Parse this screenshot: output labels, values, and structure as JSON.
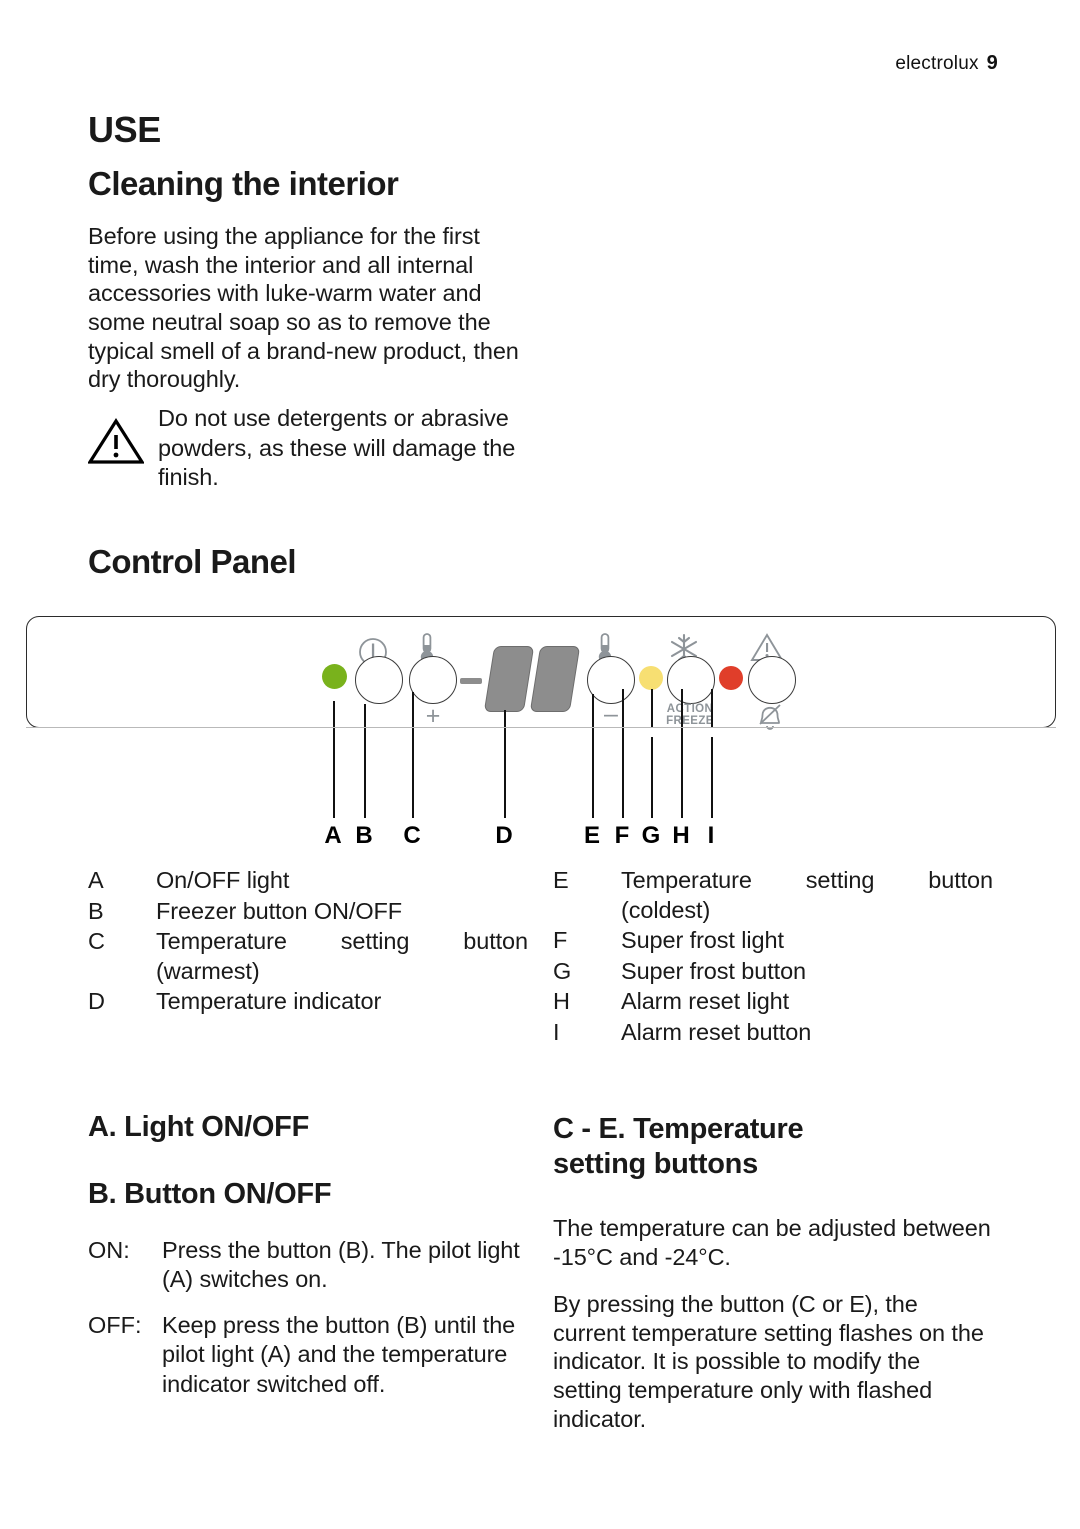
{
  "header": {
    "brand": "electrolux",
    "page_number": "9"
  },
  "sections": {
    "use_title": "USE",
    "cleaning_title": "Cleaning the interior",
    "cleaning_body": "Before using the appliance for the first time, wash the interior and all internal accessories with luke-warm water and some neutral soap so as to remove the typical smell of a brand-new product, then dry thoroughly.",
    "warning_text": "Do not use detergents or abrasive powders, as these will damage the finish.",
    "control_panel_title": "Control Panel"
  },
  "control_panel": {
    "action_freeze_label_line1": "ACTION",
    "action_freeze_label_line2": "FREEZE",
    "plus_glyph": "+",
    "minus_glyph": "–",
    "display_minus_glyph": "–",
    "callout_labels": [
      "A",
      "B",
      "C",
      "D",
      "E",
      "F",
      "G",
      "H",
      "I"
    ],
    "colors": {
      "led_green": "#79b21c",
      "led_yellow": "#f7df72",
      "led_red": "#e03e2a",
      "display_grey": "#8d8d8d",
      "icon_grey": "#8e9499"
    }
  },
  "legend_left": [
    {
      "key": "A",
      "text": "On/OFF light",
      "justify": false
    },
    {
      "key": "B",
      "text": "Freezer button ON/OFF",
      "justify": false
    },
    {
      "key": "C",
      "text": "Temperature setting button (warmest)",
      "justify": true
    },
    {
      "key": "D",
      "text": "Temperature indicator",
      "justify": false
    }
  ],
  "legend_right": [
    {
      "key": "E",
      "text": "Temperature setting button (coldest)",
      "justify": true
    },
    {
      "key": "F",
      "text": "Super frost light",
      "justify": false
    },
    {
      "key": "G",
      "text": "Super frost button",
      "justify": false
    },
    {
      "key": "H",
      "text": "Alarm reset light",
      "justify": false
    },
    {
      "key": "I",
      "text": "Alarm reset button",
      "justify": false
    }
  ],
  "light_onoff": {
    "heading_a": "A. Light ON/OFF",
    "heading_b": "B. Button ON/OFF",
    "rows": [
      {
        "key": "ON:",
        "text": "Press the button (B). The pilot light (A) switches on."
      },
      {
        "key": "OFF:",
        "text": "Keep press the button (B) until the pilot light (A) and the temperature indicator switched off."
      }
    ]
  },
  "temperature_setting": {
    "heading_line1": "C - E. Temperature",
    "heading_line2": "setting buttons",
    "para1": "The temperature can be adjusted between -15°C and -24°C.",
    "para2": "By pressing the button (C or E), the current temperature setting flashes on the indicator. It is possible to modify the setting temperature only with flashed indicator."
  }
}
